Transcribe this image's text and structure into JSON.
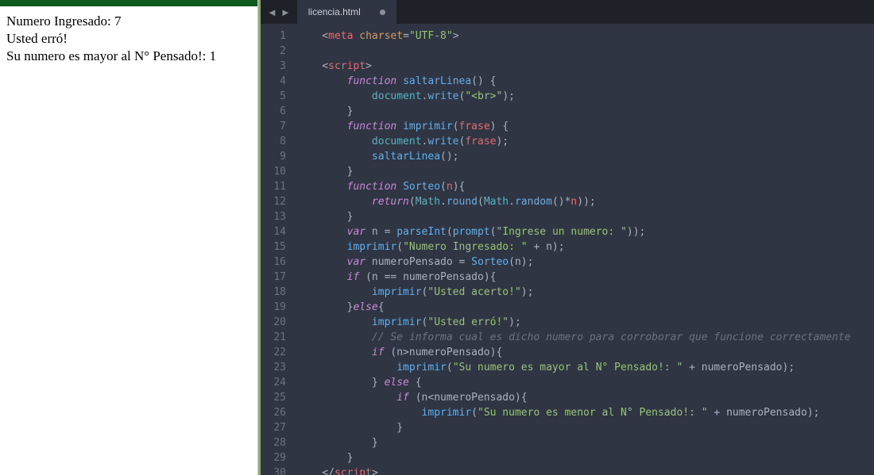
{
  "left": {
    "line1": "Numero Ingresado: 7",
    "line2": "Usted erró!",
    "line3": "Su numero es mayor al N° Pensado!: 1"
  },
  "tab": {
    "filename": "licencia.html"
  },
  "code": {
    "lines": [
      [
        [
          "p",
          "    <"
        ],
        [
          "tag",
          "meta"
        ],
        [
          "p",
          " "
        ],
        [
          "attr",
          "charset"
        ],
        [
          "p",
          "="
        ],
        [
          "str",
          "\"UTF-8\""
        ],
        [
          "p",
          ">"
        ]
      ],
      [],
      [
        [
          "p",
          "    <"
        ],
        [
          "tag",
          "script"
        ],
        [
          "p",
          ">"
        ]
      ],
      [
        [
          "p",
          "        "
        ],
        [
          "kw",
          "function"
        ],
        [
          "p",
          " "
        ],
        [
          "fnname",
          "saltarLinea"
        ],
        [
          "p",
          "() {"
        ]
      ],
      [
        [
          "p",
          "            "
        ],
        [
          "type",
          "document"
        ],
        [
          "p",
          "."
        ],
        [
          "call",
          "write"
        ],
        [
          "p",
          "("
        ],
        [
          "str",
          "\"<br>\""
        ],
        [
          "p",
          ");"
        ]
      ],
      [
        [
          "p",
          "        }"
        ]
      ],
      [
        [
          "p",
          "        "
        ],
        [
          "kw",
          "function"
        ],
        [
          "p",
          " "
        ],
        [
          "fnname",
          "imprimir"
        ],
        [
          "p",
          "("
        ],
        [
          "var",
          "frase"
        ],
        [
          "p",
          ") {"
        ]
      ],
      [
        [
          "p",
          "            "
        ],
        [
          "type",
          "document"
        ],
        [
          "p",
          "."
        ],
        [
          "call",
          "write"
        ],
        [
          "p",
          "("
        ],
        [
          "var",
          "frase"
        ],
        [
          "p",
          ");"
        ]
      ],
      [
        [
          "p",
          "            "
        ],
        [
          "call",
          "saltarLinea"
        ],
        [
          "p",
          "();"
        ]
      ],
      [
        [
          "p",
          "        }"
        ]
      ],
      [
        [
          "p",
          "        "
        ],
        [
          "kw",
          "function"
        ],
        [
          "p",
          " "
        ],
        [
          "fnname",
          "Sorteo"
        ],
        [
          "p",
          "("
        ],
        [
          "var",
          "n"
        ],
        [
          "p",
          "){"
        ]
      ],
      [
        [
          "p",
          "            "
        ],
        [
          "kw",
          "return"
        ],
        [
          "p",
          "("
        ],
        [
          "type",
          "Math"
        ],
        [
          "p",
          "."
        ],
        [
          "call",
          "round"
        ],
        [
          "p",
          "("
        ],
        [
          "type",
          "Math"
        ],
        [
          "p",
          "."
        ],
        [
          "call",
          "random"
        ],
        [
          "p",
          "()*"
        ],
        [
          "var",
          "n"
        ],
        [
          "p",
          "));"
        ]
      ],
      [
        [
          "p",
          "        }"
        ]
      ],
      [
        [
          "p",
          "        "
        ],
        [
          "kw",
          "var"
        ],
        [
          "p",
          " n = "
        ],
        [
          "call",
          "parseInt"
        ],
        [
          "p",
          "("
        ],
        [
          "call",
          "prompt"
        ],
        [
          "p",
          "("
        ],
        [
          "str",
          "\"Ingrese un numero: \""
        ],
        [
          "p",
          "));"
        ]
      ],
      [
        [
          "p",
          "        "
        ],
        [
          "call",
          "imprimir"
        ],
        [
          "p",
          "("
        ],
        [
          "str",
          "\"Numero Ingresado: \""
        ],
        [
          "p",
          " + n);"
        ]
      ],
      [
        [
          "p",
          "        "
        ],
        [
          "kw",
          "var"
        ],
        [
          "p",
          " numeroPensado = "
        ],
        [
          "call",
          "Sorteo"
        ],
        [
          "p",
          "(n);"
        ]
      ],
      [
        [
          "p",
          "        "
        ],
        [
          "kw",
          "if"
        ],
        [
          "p",
          " (n == numeroPensado){"
        ]
      ],
      [
        [
          "p",
          "            "
        ],
        [
          "call",
          "imprimir"
        ],
        [
          "p",
          "("
        ],
        [
          "str",
          "\"Usted acerto!\""
        ],
        [
          "p",
          ");"
        ]
      ],
      [
        [
          "p",
          "        }"
        ],
        [
          "kw",
          "else"
        ],
        [
          "p",
          "{"
        ]
      ],
      [
        [
          "p",
          "            "
        ],
        [
          "call",
          "imprimir"
        ],
        [
          "p",
          "("
        ],
        [
          "str",
          "\"Usted erró!\""
        ],
        [
          "p",
          ");"
        ]
      ],
      [
        [
          "p",
          "            "
        ],
        [
          "cmt",
          "// Se informa cual es dicho numero para corroborar que funcione correctamente"
        ]
      ],
      [
        [
          "p",
          "            "
        ],
        [
          "kw",
          "if"
        ],
        [
          "p",
          " (n>numeroPensado){"
        ]
      ],
      [
        [
          "p",
          "                "
        ],
        [
          "call",
          "imprimir"
        ],
        [
          "p",
          "("
        ],
        [
          "str",
          "\"Su numero es mayor al N° Pensado!: \""
        ],
        [
          "p",
          " + numeroPensado);"
        ]
      ],
      [
        [
          "p",
          "            } "
        ],
        [
          "kw",
          "else"
        ],
        [
          "p",
          " {"
        ]
      ],
      [
        [
          "p",
          "                "
        ],
        [
          "kw",
          "if"
        ],
        [
          "p",
          " (n<numeroPensado){"
        ]
      ],
      [
        [
          "p",
          "                    "
        ],
        [
          "call",
          "imprimir"
        ],
        [
          "p",
          "("
        ],
        [
          "str",
          "\"Su numero es menor al N° Pensado!: \""
        ],
        [
          "p",
          " + numeroPensado);"
        ]
      ],
      [
        [
          "p",
          "                }"
        ]
      ],
      [
        [
          "p",
          "            }"
        ]
      ],
      [
        [
          "p",
          "        }"
        ]
      ],
      [
        [
          "p",
          "    </"
        ],
        [
          "tag",
          "script"
        ],
        [
          "p",
          ">"
        ]
      ]
    ]
  }
}
